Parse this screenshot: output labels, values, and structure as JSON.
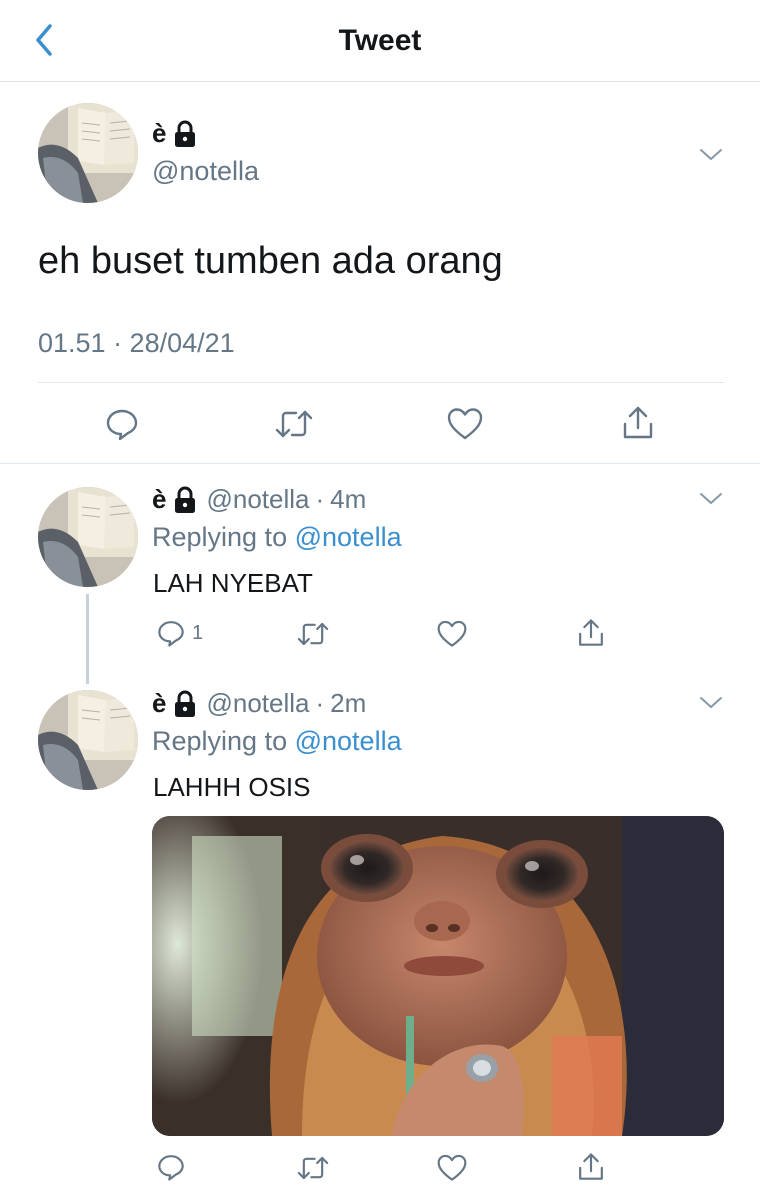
{
  "header": {
    "title": "Tweet"
  },
  "main_tweet": {
    "name": "è",
    "handle": "@notella",
    "text": "eh buset tumben ada orang",
    "timestamp": "01.51 · 28/04/21"
  },
  "replies": [
    {
      "name": "è",
      "handle": "@notella",
      "separator": "·",
      "time": "4m",
      "replying_prefix": "Replying to",
      "replying_handle": "@notella",
      "text": "LAH NYEBAT",
      "reply_count": "1"
    },
    {
      "name": "è",
      "handle": "@notella",
      "separator": "·",
      "time": "2m",
      "replying_prefix": "Replying to",
      "replying_handle": "@notella",
      "text": "LAHHH OSIS"
    }
  ],
  "icons": {
    "back": "chevron-left-icon",
    "lock": "lock-icon",
    "more": "chevron-down-icon",
    "reply": "comment-icon",
    "retweet": "retweet-icon",
    "like": "heart-icon",
    "share": "share-icon"
  },
  "colors": {
    "accent": "#3a8fd0",
    "text": "#14171a",
    "secondary": "#657786",
    "divider": "#e1e8ed"
  }
}
